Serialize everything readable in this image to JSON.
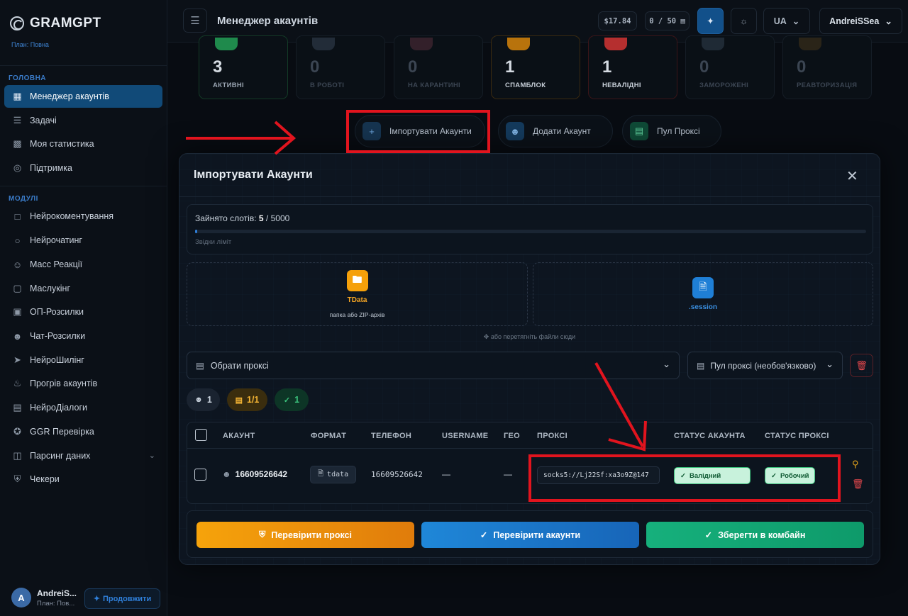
{
  "sidebar": {
    "app_name": "GRAMGPT",
    "plan": "План: Повна",
    "section_main": "ГОЛОВНА",
    "section_modules": "МОДУЛІ",
    "main_items": [
      {
        "label": "Менеджер акаунтів",
        "icon": "grid-icon"
      },
      {
        "label": "Задачі",
        "icon": "list-icon"
      },
      {
        "label": "Моя статистика",
        "icon": "chart-icon"
      },
      {
        "label": "Підтримка",
        "icon": "lifebuoy-icon"
      }
    ],
    "module_items": [
      {
        "label": "Нейрокоментування",
        "icon": "comment-icon"
      },
      {
        "label": "Нейрочатинг",
        "icon": "chat-icon"
      },
      {
        "label": "Масс Реакції",
        "icon": "smile-icon"
      },
      {
        "label": "Маслукінг",
        "icon": "monitor-icon"
      },
      {
        "label": "ОП-Розсилки",
        "icon": "message-icon"
      },
      {
        "label": "Чат-Розсилки",
        "icon": "users-icon"
      },
      {
        "label": "НейроШилінг",
        "icon": "rocket-icon"
      },
      {
        "label": "Прогрів акаунтів",
        "icon": "flame-icon"
      },
      {
        "label": "НейроДіалоги",
        "icon": "dialog-icon"
      },
      {
        "label": "GGR Перевірка",
        "icon": "star-icon"
      },
      {
        "label": "Парсинг даних",
        "icon": "database-icon"
      },
      {
        "label": "Чекери",
        "icon": "shield-icon"
      }
    ],
    "user_name": "AndreiS...",
    "user_plan": "План: Пов...",
    "avatar_letter": "A",
    "continue_label": "Продовжити"
  },
  "header": {
    "title": "Менеджер акаунтів",
    "balance": "$17.84",
    "counter": "0 / 50",
    "language": "UA",
    "user": "AndreiSSea"
  },
  "stats": [
    {
      "value": "3",
      "label": "АКТИВНІ",
      "color": "#22c55e"
    },
    {
      "value": "0",
      "label": "В РОБОТІ",
      "color": "#6b7684"
    },
    {
      "value": "0",
      "label": "НА КАРАНТИНІ",
      "color": "#6b7684"
    },
    {
      "value": "1",
      "label": "СПАМБЛОК",
      "color": "#f5a524"
    },
    {
      "value": "1",
      "label": "НЕВАЛІДНІ",
      "color": "#ef4444"
    },
    {
      "value": "0",
      "label": "ЗАМОРОЖЕНІ",
      "color": "#6b7684"
    },
    {
      "value": "0",
      "label": "РЕАВТОРИЗАЦІЯ",
      "color": "#6b7684"
    }
  ],
  "actions": {
    "import": "Імпортувати Акаунти",
    "add": "Додати Акаунт",
    "proxy_pool": "Пул Проксі"
  },
  "modal": {
    "title": "Імпортувати Акаунти",
    "slots_label": "Зайнято слотів:",
    "slots_used": "5",
    "slots_total": "/ 5000",
    "slots_fraction": 0.001,
    "limit_hint": "Звідки ліміт",
    "tdata_label": "TData",
    "tdata_sub": "папка або ZIP-архів",
    "session_label": ".session",
    "drag_hint": "або перетягніть файли сюди",
    "proxy_select": "Обрати проксі",
    "proxy_pool_select": "Пул проксі (необов'язково)",
    "pill_accounts": "1",
    "pill_proxies": "1/1",
    "pill_valid": "1",
    "columns": [
      "АКАУНТ",
      "ФОРМАТ",
      "ТЕЛЕФОН",
      "USERNAME",
      "ГЕО",
      "ПРОКСІ",
      "СТАТУС АКАУНТА",
      "СТАТУС ПРОКСІ"
    ],
    "row": {
      "account": "16609526642",
      "format": "tdata",
      "phone": "16609526642",
      "username": "—",
      "geo": "—",
      "proxy": "socks5://Lj22Sf:xa3o9Z@147",
      "account_status": "Валідний",
      "proxy_status": "Робочий"
    },
    "btn_check_proxy": "Перевірити проксі",
    "btn_check_accounts": "Перевірити акаунти",
    "btn_save": "Зберегти в комбайн"
  },
  "colors": {
    "accent": "#2f7fd9",
    "orange": "#f5a00a",
    "green": "#13a876",
    "annotation_red": "#e1141e"
  }
}
